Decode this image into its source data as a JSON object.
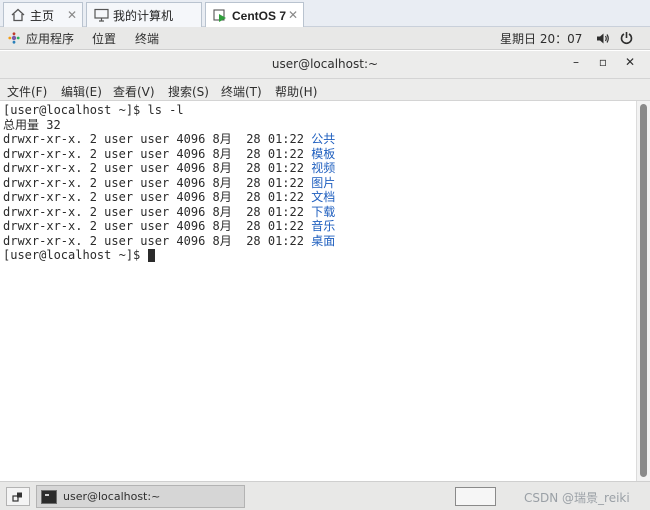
{
  "vm_tabs": [
    {
      "label": "主页",
      "icon": "home-icon"
    },
    {
      "label": "我的计算机",
      "icon": "computer-icon"
    },
    {
      "label": "CentOS 7",
      "icon": "vm-play-icon",
      "active": true
    }
  ],
  "panel": {
    "applications": "应用程序",
    "places": "位置",
    "terminal": "终端",
    "clock": "星期日 20：07",
    "volume_icon": "speaker-icon",
    "power_icon": "power-icon"
  },
  "window": {
    "title": "user@localhost:~",
    "minimize": "–",
    "maximize": "▫",
    "close": "✕"
  },
  "menubar": [
    "文件(F)",
    "编辑(E)",
    "查看(V)",
    "搜索(S)",
    "终端(T)",
    "帮助(H)"
  ],
  "terminal": {
    "prompt": "[user@localhost ~]$ ",
    "command": "ls -l",
    "total": "总用量 32",
    "entries": [
      {
        "meta": "drwxr-xr-x. 2 user user 4096 8月  28 01:22 ",
        "name": "公共"
      },
      {
        "meta": "drwxr-xr-x. 2 user user 4096 8月  28 01:22 ",
        "name": "模板"
      },
      {
        "meta": "drwxr-xr-x. 2 user user 4096 8月  28 01:22 ",
        "name": "视频"
      },
      {
        "meta": "drwxr-xr-x. 2 user user 4096 8月  28 01:22 ",
        "name": "图片"
      },
      {
        "meta": "drwxr-xr-x. 2 user user 4096 8月  28 01:22 ",
        "name": "文档"
      },
      {
        "meta": "drwxr-xr-x. 2 user user 4096 8月  28 01:22 ",
        "name": "下载"
      },
      {
        "meta": "drwxr-xr-x. 2 user user 4096 8月  28 01:22 ",
        "name": "音乐"
      },
      {
        "meta": "drwxr-xr-x. 2 user user 4096 8月  28 01:22 ",
        "name": "桌面"
      }
    ],
    "final_prompt": "[user@localhost ~]$ ",
    "directory_color": "#1f5fbf"
  },
  "taskbar": {
    "task_label": "user@localhost:~",
    "watermark": "CSDN @瑞景_reiki"
  }
}
